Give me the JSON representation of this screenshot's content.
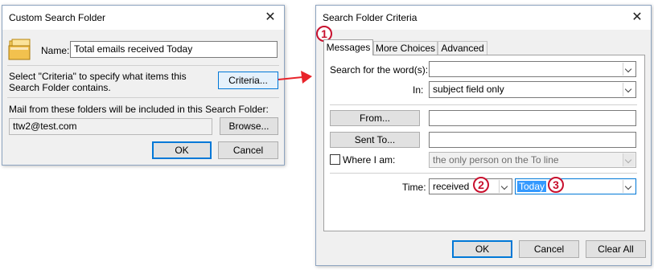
{
  "left_dialog": {
    "title": "Custom Search Folder",
    "close_glyph": "✕",
    "name_label": "Name:",
    "name_value": "Total emails received Today",
    "criteria_text": "Select \"Criteria\" to specify what items this Search Folder contains.",
    "criteria_button": "Criteria...",
    "mail_from_text": "Mail from these folders will be included in this Search Folder:",
    "folder_value": "ttw2@test.com",
    "browse_button": "Browse...",
    "ok_button": "OK",
    "cancel_button": "Cancel",
    "icon": "folder-stack-icon"
  },
  "right_dialog": {
    "title": "Search Folder Criteria",
    "close_glyph": "✕",
    "tabs": [
      {
        "label": "Messages",
        "active": true
      },
      {
        "label": "More Choices",
        "active": false
      },
      {
        "label": "Advanced",
        "active": false
      }
    ],
    "search_words_label": "Search for the word(s):",
    "search_words_value": "",
    "in_label": "In:",
    "in_value": "subject field only",
    "from_button": "From...",
    "from_value": "",
    "sent_to_button": "Sent To...",
    "sent_to_value": "",
    "where_label": "Where I am:",
    "where_value": "the only person on the To line",
    "time_label": "Time:",
    "time_value": "received",
    "time_period_value": "Today",
    "ok_button": "OK",
    "cancel_button": "Cancel",
    "clear_all_button": "Clear All"
  },
  "annotations": [
    "1",
    "2",
    "3"
  ],
  "colors": {
    "arrow": "#e8232a",
    "badge": "#c8102e",
    "selection": "#3399ff",
    "focus_border": "#0078d7"
  }
}
